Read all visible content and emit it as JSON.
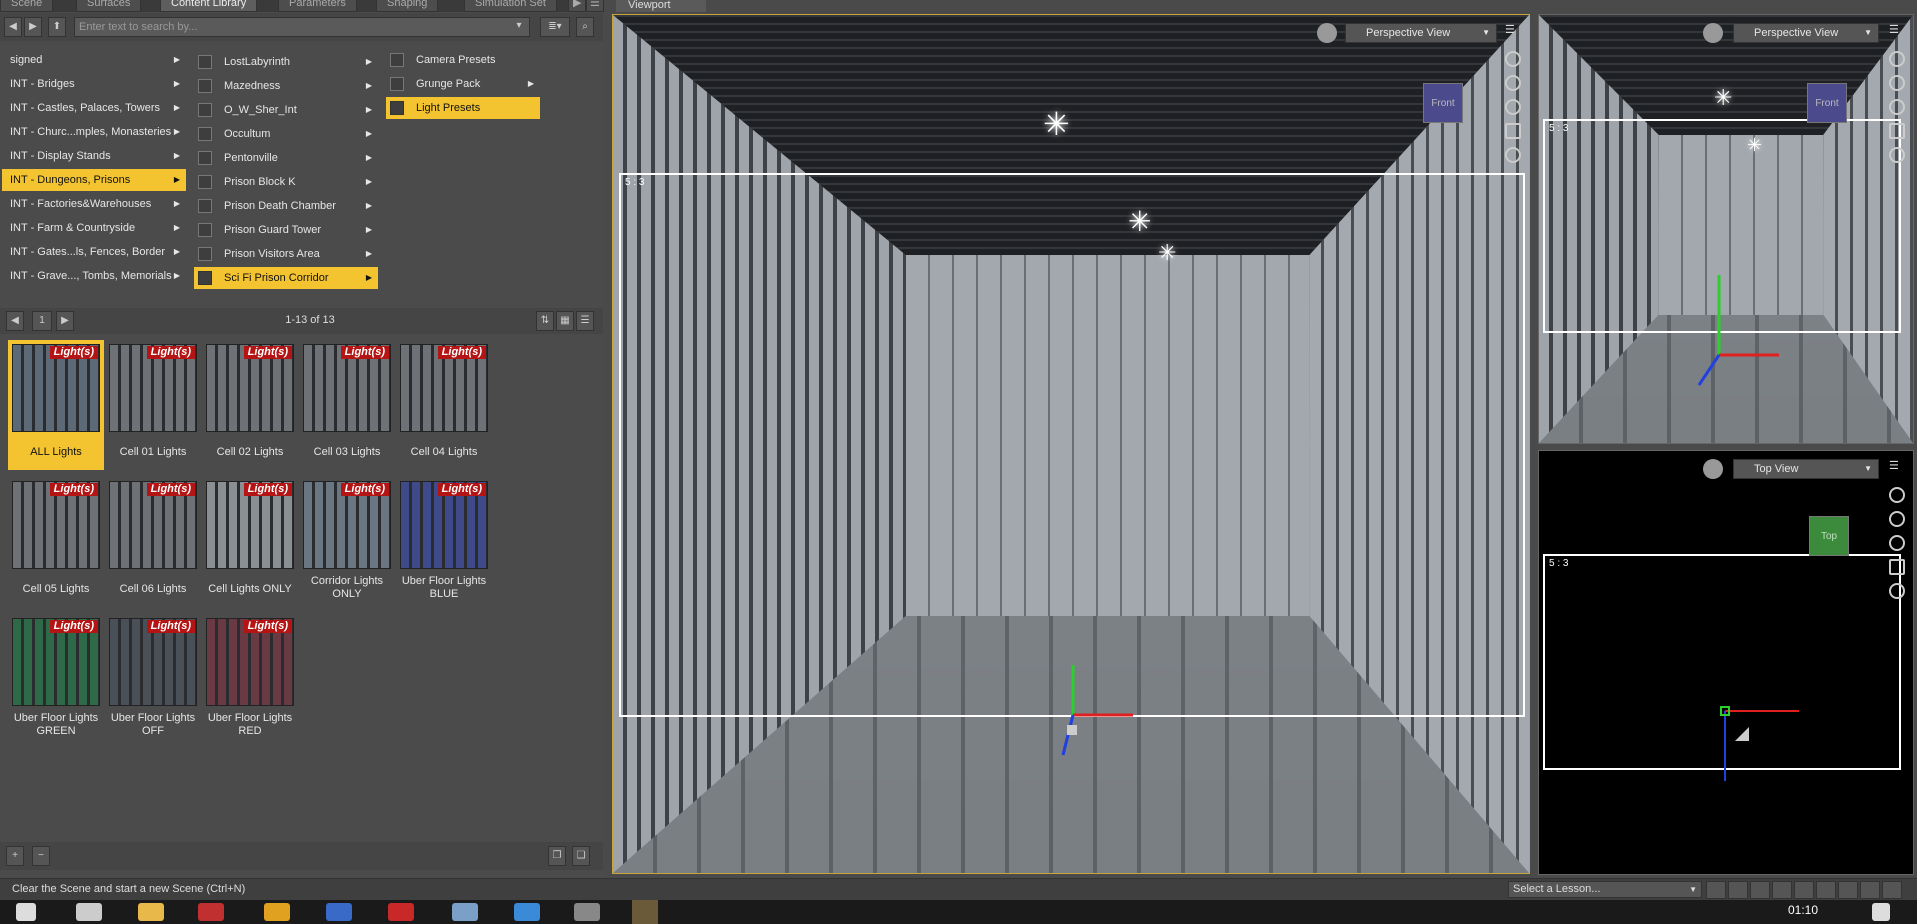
{
  "top_tabs": [
    "Scene",
    "Surfaces",
    "Content Library",
    "Parameters",
    "Shaping",
    "Simulation Set"
  ],
  "active_tab": "Content Library",
  "viewport_tab": "Viewport",
  "search": {
    "placeholder": "Enter text to search by..."
  },
  "categories": [
    {
      "label": "signed"
    },
    {
      "label": "INT - Bridges"
    },
    {
      "label": "INT - Castles, Palaces, Towers"
    },
    {
      "label": "INT - Churc...mples, Monasteries"
    },
    {
      "label": "INT - Display Stands"
    },
    {
      "label": "INT - Dungeons, Prisons"
    },
    {
      "label": "INT - Factories&Warehouses"
    },
    {
      "label": "INT - Farm & Countryside"
    },
    {
      "label": "INT - Gates...ls, Fences, Border"
    },
    {
      "label": "INT - Grave..., Tombs, Memorials"
    }
  ],
  "selected_category": "INT - Dungeons, Prisons",
  "products": [
    {
      "label": "LostLabyrinth"
    },
    {
      "label": "Mazedness"
    },
    {
      "label": "O_W_Sher_Int"
    },
    {
      "label": "Occultum"
    },
    {
      "label": "Pentonville"
    },
    {
      "label": "Prison Block K"
    },
    {
      "label": "Prison Death Chamber"
    },
    {
      "label": "Prison Guard Tower"
    },
    {
      "label": "Prison Visitors Area"
    },
    {
      "label": "Sci Fi Prison Corridor"
    }
  ],
  "selected_product": "Sci Fi Prison Corridor",
  "subfolders": [
    {
      "label": "Camera Presets"
    },
    {
      "label": "Grunge Pack"
    },
    {
      "label": "Light Presets"
    }
  ],
  "selected_subfolder": "Light Presets",
  "pager": {
    "page": "1",
    "range": "1-13 of 13"
  },
  "badge_text": "Light(s)",
  "items": [
    {
      "label": "ALL Lights",
      "tint": "#5c6a78"
    },
    {
      "label": "Cell 01 Lights",
      "tint": "#6e7276"
    },
    {
      "label": "Cell 02 Lights",
      "tint": "#6e7276"
    },
    {
      "label": "Cell 03 Lights",
      "tint": "#6e7276"
    },
    {
      "label": "Cell 04 Lights",
      "tint": "#6e7276"
    },
    {
      "label": "Cell 05 Lights",
      "tint": "#6e7276"
    },
    {
      "label": "Cell 06 Lights",
      "tint": "#6e7276"
    },
    {
      "label": "Cell Lights ONLY",
      "tint": "#8a8f94"
    },
    {
      "label": "Corridor Lights ONLY",
      "tint": "#6a7682"
    },
    {
      "label": "Uber Floor Lights BLUE",
      "tint": "#3e4a8a"
    },
    {
      "label": "Uber Floor Lights GREEN",
      "tint": "#2e6a48"
    },
    {
      "label": "Uber Floor Lights OFF",
      "tint": "#4a5058"
    },
    {
      "label": "Uber Floor Lights RED",
      "tint": "#6a3a44"
    }
  ],
  "status_text": "Clear the Scene and start a new Scene (Ctrl+N)",
  "lesson_select": "Select a Lesson...",
  "viewports": {
    "main": {
      "view": "Perspective View",
      "ratio": "5 : 3",
      "cube": "Front"
    },
    "right_top": {
      "view": "Perspective View",
      "ratio": "5 : 3",
      "cube": "Front"
    },
    "right_bottom": {
      "view": "Top View",
      "ratio": "5 : 3",
      "cube": "Top"
    }
  },
  "clock": "01:10",
  "colors": {
    "accent": "#f4c430",
    "badge": "#b51414"
  }
}
